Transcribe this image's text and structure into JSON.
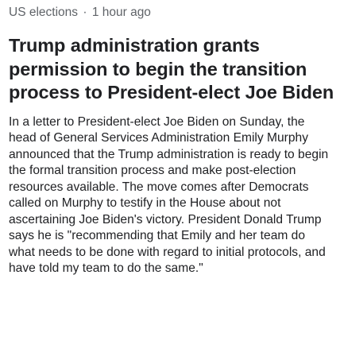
{
  "story": {
    "category": "US elections",
    "separator": "·",
    "time_ago": "1 hour ago",
    "headline": "Trump administration grants permission to begin the transition process to President-elect Joe Biden",
    "summary": "In a letter to President-elect Joe Biden on Sunday, the head of General Services Administration Emily Murphy announced that the Trump administration is ready to begin the formal transition process and make post-election resources available. The move comes after Democrats called on Murphy to testify in the House about not ascertaining Joe Biden's victory. President Donald Trump says he is \"recommending that Emily and her team do what needs to be done with regard to initial protocols, and have told my team to do the same.\""
  }
}
